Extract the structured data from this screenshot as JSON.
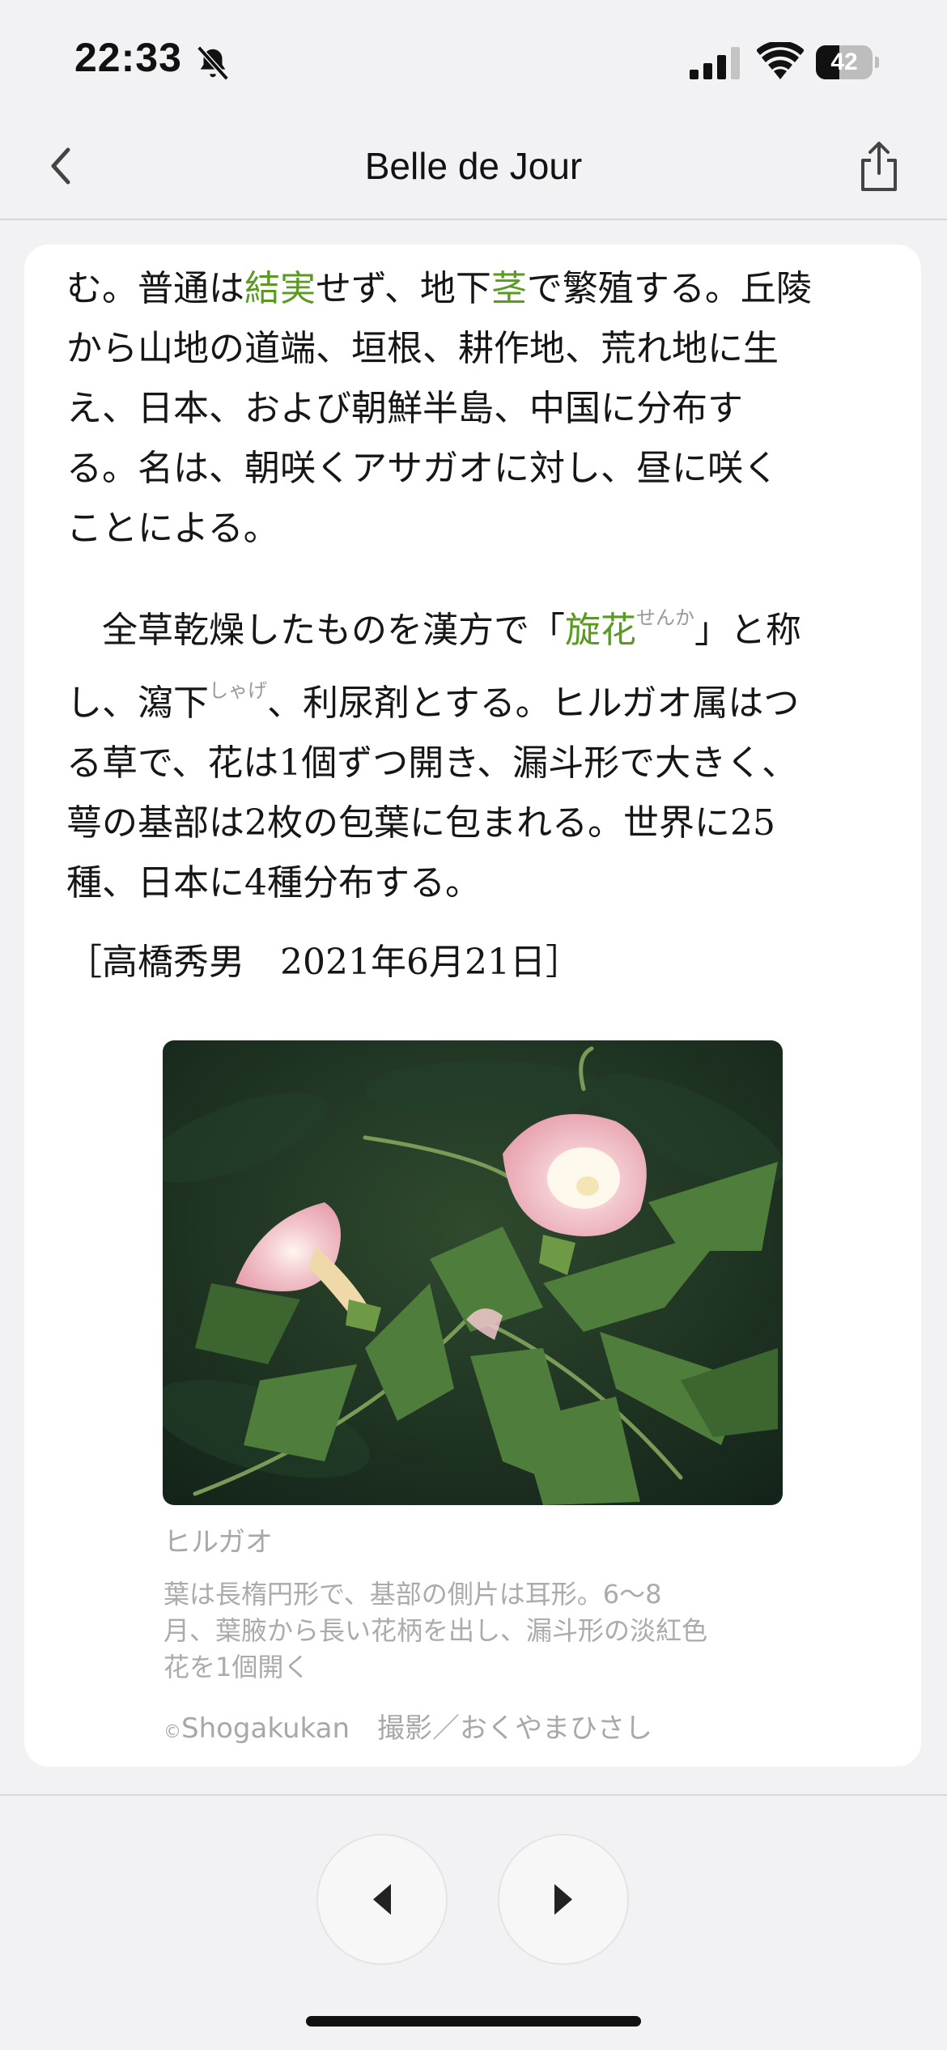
{
  "status_bar": {
    "time": "22:33",
    "battery_level": "42",
    "battery_percent": 42,
    "icons": [
      "bell-slash-icon",
      "cellular-signal-icon",
      "wifi-icon",
      "battery-icon"
    ]
  },
  "nav": {
    "title": "Belle de Jour",
    "back_icon": "chevron-left-icon",
    "share_icon": "share-icon"
  },
  "article": {
    "para1": [
      {
        "segments": [
          {
            "t": "む。普通は"
          },
          {
            "t": "結実",
            "link": true
          },
          {
            "t": "せず、地下"
          },
          {
            "t": "茎",
            "link": true
          },
          {
            "t": "で繁殖する。丘陵"
          }
        ]
      },
      {
        "segments": [
          {
            "t": "から山地の道端、垣根、耕作地、荒れ地に生"
          }
        ]
      },
      {
        "segments": [
          {
            "t": "え、日本、および朝鮮半島、中国に分布す"
          }
        ]
      },
      {
        "segments": [
          {
            "t": "る。名は、朝咲くアサガオに対し、昼に咲く"
          }
        ]
      },
      {
        "segments": [
          {
            "t": "ことによる。"
          }
        ]
      }
    ],
    "para2": [
      {
        "segments": [
          {
            "t": "　全草乾燥したものを漢方で「"
          },
          {
            "t": "旋花",
            "link": true
          },
          {
            "t": "せんか",
            "ruby": true
          },
          {
            "t": "」と称"
          }
        ]
      },
      {
        "segments": [
          {
            "t": "し、瀉下"
          },
          {
            "t": "しゃげ",
            "ruby": true
          },
          {
            "t": "、利尿剤とする。ヒルガオ属はつ"
          }
        ]
      },
      {
        "segments": [
          {
            "t": "る草で、花は1個ずつ開き、漏斗形で大きく、"
          }
        ]
      },
      {
        "segments": [
          {
            "t": "萼の基部は2枚の包葉に包まれる。世界に25"
          }
        ]
      },
      {
        "segments": [
          {
            "t": "種、日本に4種分布する。"
          }
        ]
      }
    ],
    "credit": "［高橋秀男　2021年6月21日］"
  },
  "figure": {
    "title": "ヒルガオ",
    "caption_lines": [
      "葉は長楕円形で、基部の側片は耳形。6〜8",
      "月、葉腋から長い花柄を出し、漏斗形の淡紅色",
      "花を1個開く"
    ],
    "copyright_mark": "©",
    "copyright": "Shogakukan　撮影／おくやまひさし"
  },
  "bottom_nav": {
    "prev_icon": "triangle-left-icon",
    "next_icon": "triangle-right-icon"
  },
  "colors": {
    "link": "#5a9a22",
    "background": "#f2f2f4",
    "card": "#ffffff",
    "caption": "#a8a8a8"
  }
}
